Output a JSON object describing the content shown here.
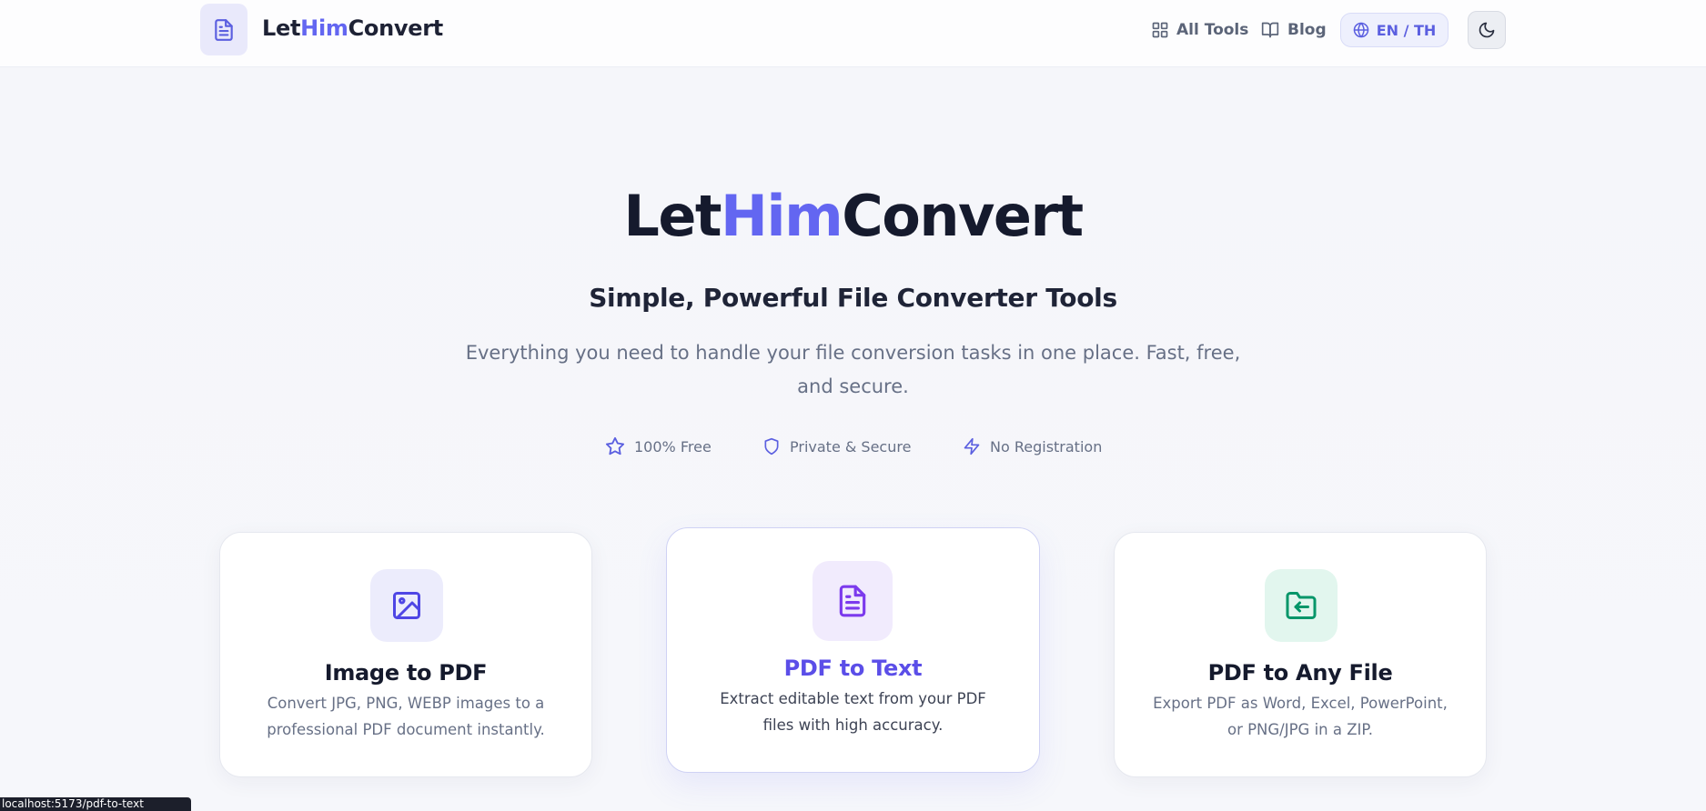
{
  "header": {
    "logo_icon": "document-icon",
    "brand": {
      "part1": "Let",
      "part2": "Him",
      "part3": "Convert"
    },
    "nav": [
      {
        "label": "All Tools",
        "icon": "grid-icon"
      },
      {
        "label": "Blog",
        "icon": "book-icon"
      }
    ],
    "language": {
      "label": "EN / TH",
      "icon": "globe-icon"
    },
    "theme_toggle_icon": "moon-icon"
  },
  "hero": {
    "title": {
      "part1": "Let",
      "part2": "Him",
      "part3": "Convert"
    },
    "subtitle": "Simple, Powerful File Converter Tools",
    "description": "Everything you need to handle your file conversion tasks in one place. Fast, free, and secure."
  },
  "features": [
    {
      "label": "100% Free",
      "icon": "star-icon"
    },
    {
      "label": "Private & Secure",
      "icon": "shield-icon"
    },
    {
      "label": "No Registration",
      "icon": "lightning-icon"
    }
  ],
  "tools": [
    {
      "title": "Image to PDF",
      "description": "Convert JPG, PNG, WEBP images to a professional PDF document instantly.",
      "icon": "image-icon",
      "color": "#4f46e5",
      "bg": "#ececfc"
    },
    {
      "title": "PDF to Text",
      "description": "Extract editable text from your PDF files with high accuracy.",
      "icon": "document-text-icon",
      "color": "#7c3aed",
      "bg": "#f1ebfd"
    },
    {
      "title": "PDF to Any File",
      "description": "Export PDF as Word, Excel, PowerPoint, or PNG/JPG in a ZIP.",
      "icon": "folder-export-icon",
      "color": "#059669",
      "bg": "#e2f6ee"
    }
  ],
  "status_url": "localhost:5173/pdf-to-text",
  "colors": {
    "accent": "#6366f1",
    "text_dark": "#151a2d",
    "text_muted": "#677086"
  }
}
